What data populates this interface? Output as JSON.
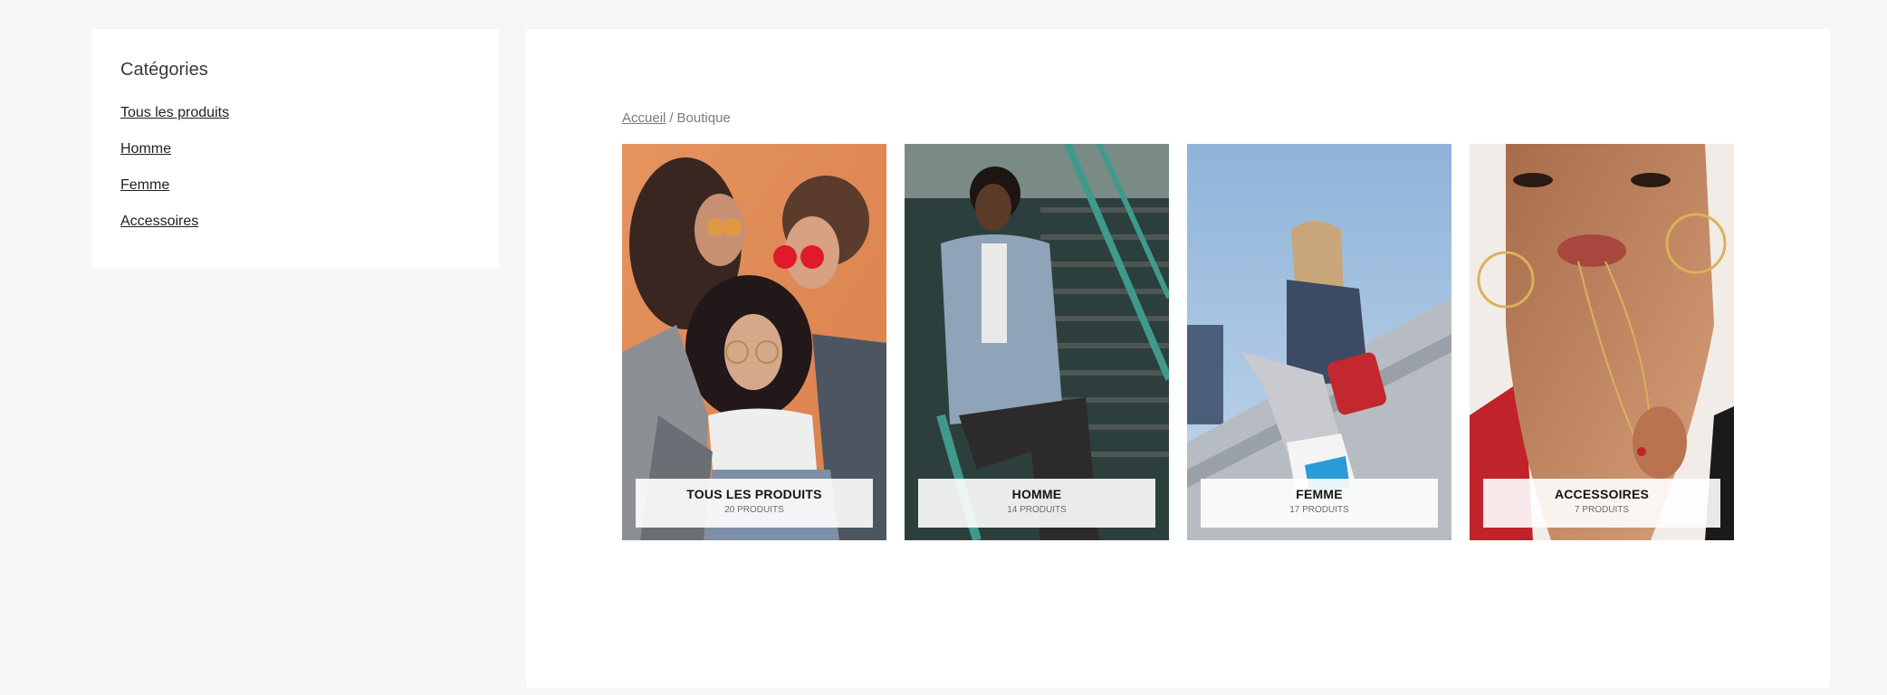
{
  "sidebar": {
    "title": "Catégories",
    "items": [
      {
        "label": "Tous les produits"
      },
      {
        "label": "Homme"
      },
      {
        "label": "Femme"
      },
      {
        "label": "Accessoires"
      }
    ]
  },
  "breadcrumb": {
    "home": "Accueil",
    "separator": "/",
    "current": "Boutique"
  },
  "categories": [
    {
      "title": "TOUS LES PRODUITS",
      "count": "20 PRODUITS"
    },
    {
      "title": "HOMME",
      "count": "14 PRODUITS"
    },
    {
      "title": "FEMME",
      "count": "17 PRODUITS"
    },
    {
      "title": "ACCESSOIRES",
      "count": "7 PRODUITS"
    }
  ]
}
